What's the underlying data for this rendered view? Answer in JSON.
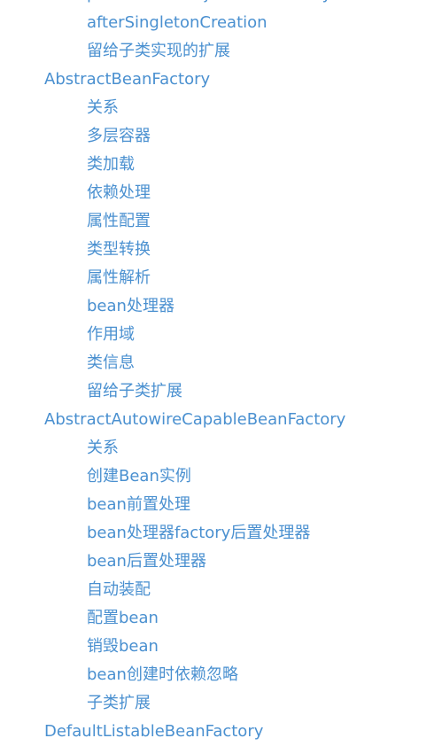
{
  "toc": {
    "partial_top": "postProcessObjectFromFactoryBean",
    "s1": {
      "items": [
        "afterSingletonCreation",
        "留给子类实现的扩展"
      ]
    },
    "s2": {
      "title": "AbstractBeanFactory",
      "items": [
        "关系",
        "多层容器",
        "类加载",
        "依赖处理",
        "属性配置",
        "类型转换",
        "属性解析",
        "bean处理器",
        "作用域",
        "类信息",
        "留给子类扩展"
      ]
    },
    "s3": {
      "title": "AbstractAutowireCapableBeanFactory",
      "items": [
        "关系",
        "创建Bean实例",
        "bean前置处理",
        "bean处理器factory后置处理器",
        "bean后置处理器",
        "自动装配",
        "配置bean",
        "销毁bean",
        "bean创建时依赖忽略",
        "子类扩展"
      ]
    },
    "partial_bottom": "DefaultListableBeanFactory"
  }
}
